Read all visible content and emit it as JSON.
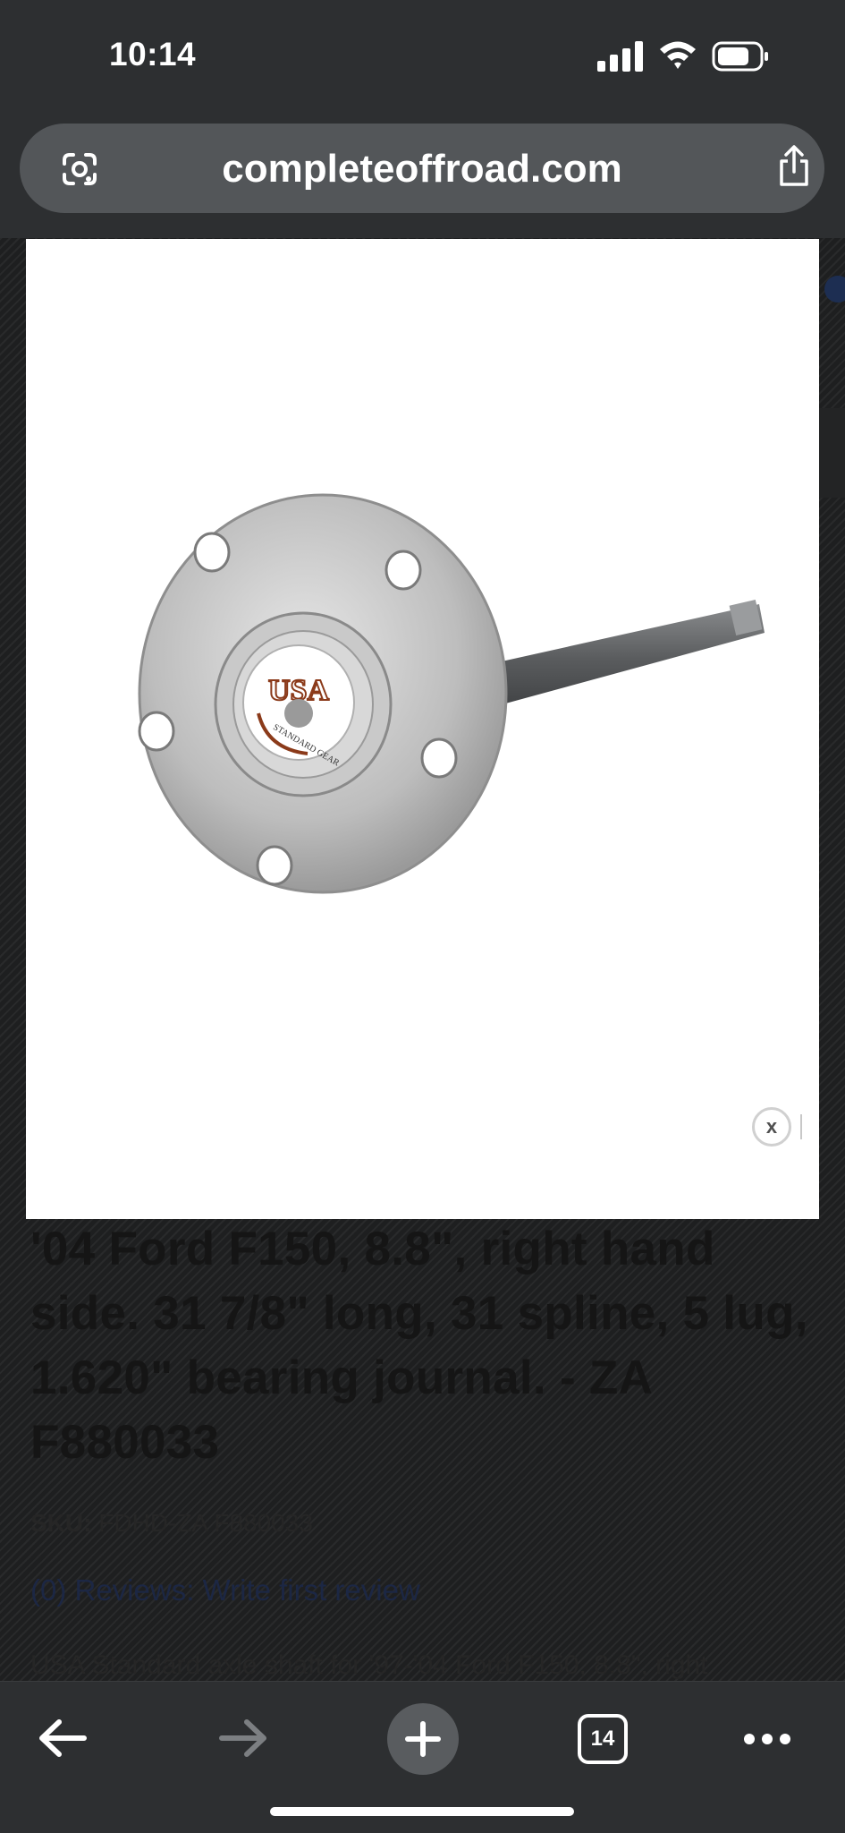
{
  "status_bar": {
    "time": "10:14",
    "icons": [
      "signal-icon",
      "wifi-icon",
      "battery-icon"
    ]
  },
  "address_bar": {
    "url": "completeoffroad.com",
    "icons": [
      "lens-icon",
      "share-icon"
    ]
  },
  "product": {
    "title": "'04 Ford F150, 8.8\", right hand side. 31 7/8\" long, 31 spline, 5 lug, 1.620\" bearing journal. - ZA F880033",
    "sku_label": "SKU:",
    "sku_value": "FDHD-ZA F880033",
    "reviews_link": "(0) Reviews: Write first review",
    "description": "USA Standard axle shaft for '97-'04 Ford F150, 8.8\", right"
  },
  "modal": {
    "image_name": "axle-shaft-image",
    "logo_text_main": "USA",
    "logo_text_sub": "STANDARD GEAR",
    "close_label": "x"
  },
  "toolbar": {
    "tab_count": "14",
    "icons": [
      "back-arrow-icon",
      "forward-arrow-icon",
      "plus-icon",
      "tabs-icon",
      "more-icon"
    ]
  }
}
